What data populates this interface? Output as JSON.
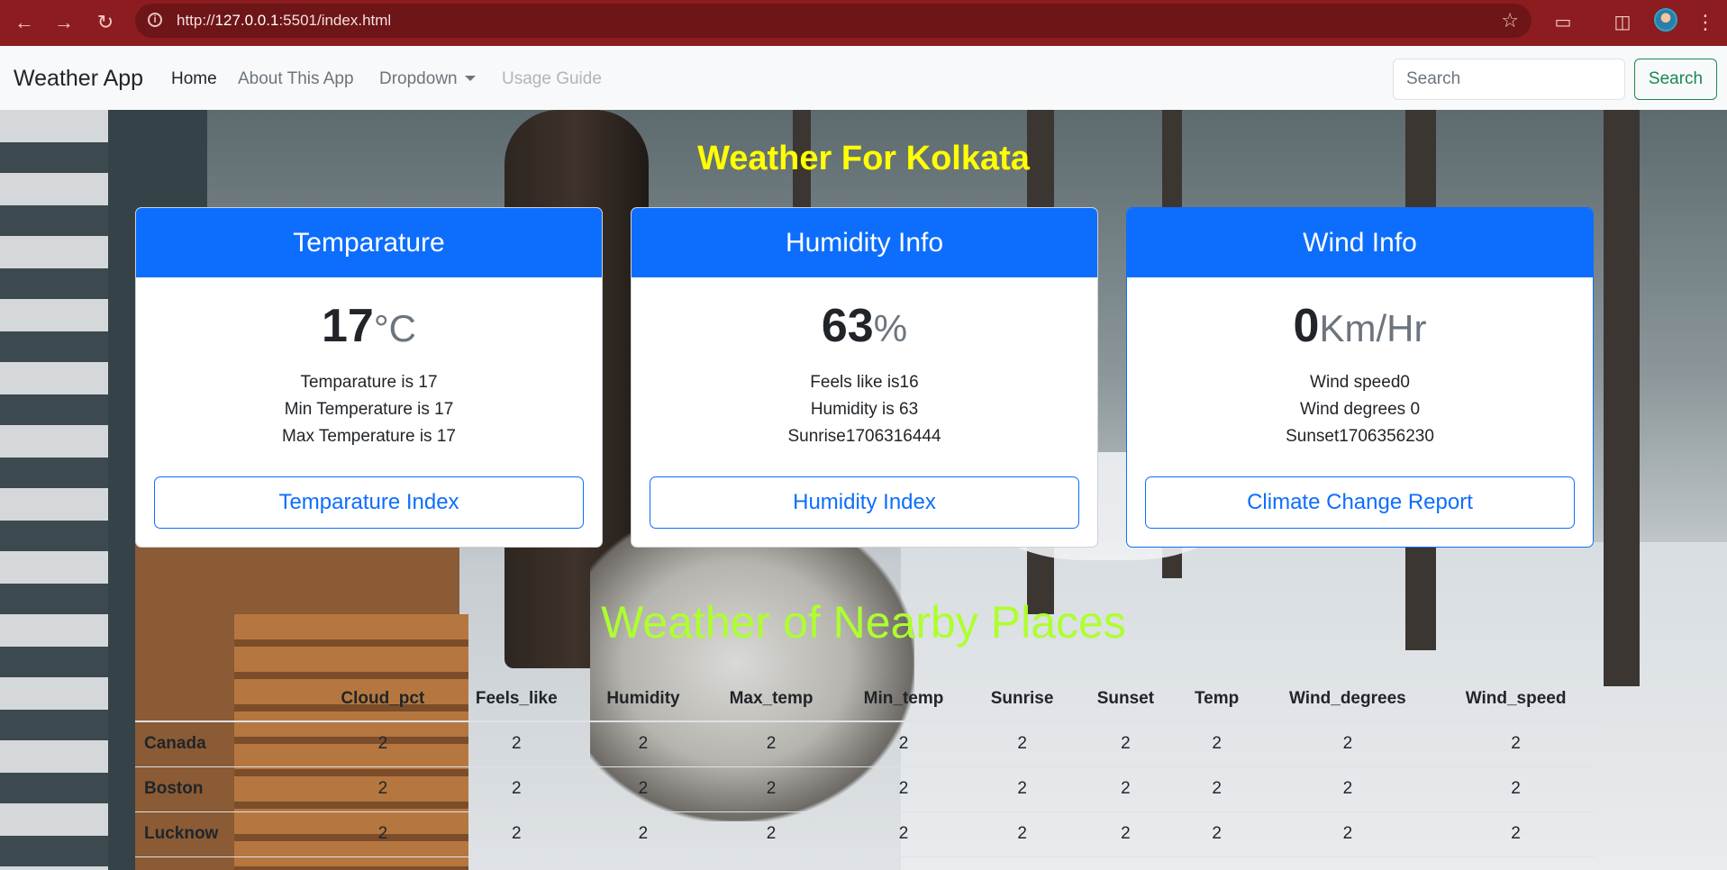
{
  "browser": {
    "url": "http://127.0.0.1:5501/index.html",
    "url_host": "127.0.0.1",
    "url_prefix": "http://",
    "url_suffix": ":5501/index.html"
  },
  "navbar": {
    "brand": "Weather App",
    "links": [
      {
        "label": "Home",
        "state": "active"
      },
      {
        "label": "About This App",
        "state": "normal"
      },
      {
        "label": "Dropdown",
        "state": "dropdown"
      },
      {
        "label": "Usage Guide",
        "state": "disabled"
      }
    ],
    "search_placeholder": "Search",
    "search_button": "Search"
  },
  "main": {
    "title": "Weather For Kolkata",
    "cards": [
      {
        "header": "Temparature",
        "value": "17",
        "unit": "°C",
        "lines": [
          "Temparature is 17",
          "Min Temperature is 17",
          "Max Temperature is 17"
        ],
        "button": "Temparature Index"
      },
      {
        "header": "Humidity Info",
        "value": "63",
        "unit": "%",
        "lines": [
          "Feels like is16",
          "Humidity is 63",
          "Sunrise1706316444"
        ],
        "button": "Humidity Index"
      },
      {
        "header": "Wind Info",
        "value": "0",
        "unit": "Km/Hr",
        "lines": [
          "Wind speed0",
          "Wind degrees 0",
          "Sunset1706356230"
        ],
        "button": "Climate Change Report"
      }
    ],
    "nearby": {
      "title": "Weather of Nearby Places",
      "columns": [
        "",
        "Cloud_pct",
        "Feels_like",
        "Humidity",
        "Max_temp",
        "Min_temp",
        "Sunrise",
        "Sunset",
        "Temp",
        "Wind_degrees",
        "Wind_speed"
      ],
      "rows": [
        {
          "place": "Canada",
          "values": [
            "2",
            "2",
            "2",
            "2",
            "2",
            "2",
            "2",
            "2",
            "2",
            "2"
          ]
        },
        {
          "place": "Boston",
          "values": [
            "2",
            "2",
            "2",
            "2",
            "2",
            "2",
            "2",
            "2",
            "2",
            "2"
          ]
        },
        {
          "place": "Lucknow",
          "values": [
            "2",
            "2",
            "2",
            "2",
            "2",
            "2",
            "2",
            "2",
            "2",
            "2"
          ]
        }
      ]
    }
  },
  "colors": {
    "title": "#ffff00",
    "section_title": "#adff2f",
    "primary": "#0d6efd",
    "success": "#198754",
    "chrome": "#8c1c20"
  }
}
